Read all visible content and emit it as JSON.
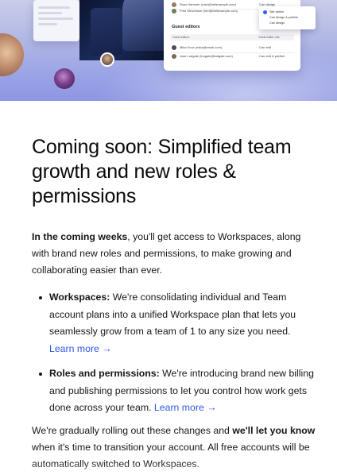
{
  "hero": {
    "panel": {
      "members": [
        {
          "name": "Russ Hammer (russ@hellexample.com)",
          "role": "Can design"
        },
        {
          "name": "Fred Stevenson (fred@hellexample.com)",
          "role": ""
        }
      ],
      "guest_heading": "Guest editors",
      "table_headers": [
        "Guest editors",
        "Guest editor role"
      ],
      "guests": [
        {
          "name": "Mika Knox (mika@email.com)",
          "role": "Can edit"
        },
        {
          "name": "Jose Ludgate (lnugate@ludgate.com)",
          "role": "Can edit & publish"
        }
      ]
    },
    "dropdown": {
      "options": [
        "Site admin",
        "Can design & publish",
        "Can design"
      ],
      "selected": "Site admin"
    }
  },
  "article": {
    "title": "Coming soon: Simplified team growth and new roles & permissions",
    "intro_bold": "In the coming weeks",
    "intro_rest": ", you'll get access to Workspaces, along with brand new roles and permissions, to make growing and collaborating easier than ever.",
    "bullets": [
      {
        "term": "Workspaces:",
        "text": " We're consolidating individual and Team account plans into a unified Workspace plan that lets you seamlessly grow from a team of 1 to any size you need. ",
        "link": "Learn more →"
      },
      {
        "term": "Roles and permissions:",
        "text": " We're introducing brand new billing and publishing permissions to let you control how work gets done across your team. ",
        "link": "Learn more →"
      }
    ],
    "closing_start": "We're gradually rolling out these changes and ",
    "closing_bold": "we'll let you know",
    "closing_rest": " when it's time to transition your account. All free accounts will be automatically switched to Workspaces."
  },
  "colors": {
    "link": "#2d57e6",
    "hero_top": "#c9cde9",
    "hero_bottom": "#8d96e2",
    "accent_check": "#2d5bff"
  }
}
